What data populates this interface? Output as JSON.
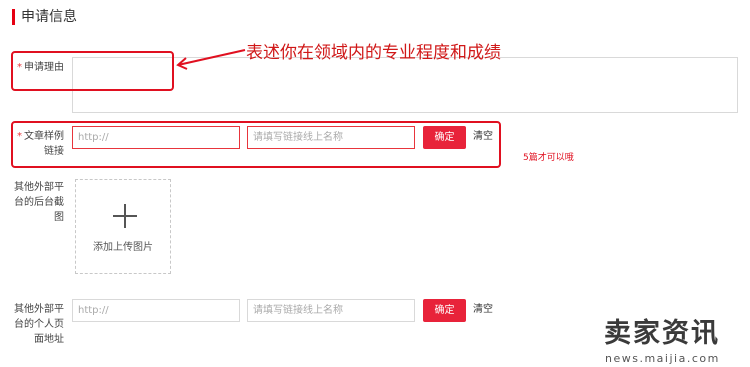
{
  "section": {
    "title": "申请信息"
  },
  "fields": {
    "reason": {
      "required_mark": "*",
      "label": "申请理由",
      "value": ""
    },
    "sample": {
      "required_mark": "*",
      "label_line1": "文章样例",
      "label_line2": "链接",
      "url_placeholder": "http://",
      "name_placeholder": "请填写链接线上名称",
      "confirm_label": "确定",
      "clear_label": "清空"
    },
    "screenshot": {
      "label_line1": "其他外部平",
      "label_line2": "台的后台截",
      "label_line3": "图",
      "upload_label": "添加上传图片"
    },
    "homepage": {
      "label_line1": "其他外部平",
      "label_line2": "台的个人页",
      "label_line3": "面地址",
      "url_placeholder": "http://",
      "name_placeholder": "请填写链接线上名称",
      "confirm_label": "确定",
      "clear_label": "清空"
    }
  },
  "annotations": {
    "reason_note": "表述你在领域内的专业程度和成绩",
    "sample_note": "5篇才可以哦"
  },
  "watermark": {
    "main": "卖家资讯",
    "sub": "news.maijia.com"
  },
  "colors": {
    "accent": "#e8233a",
    "annotation": "#e01020",
    "required": "#e8353c"
  }
}
